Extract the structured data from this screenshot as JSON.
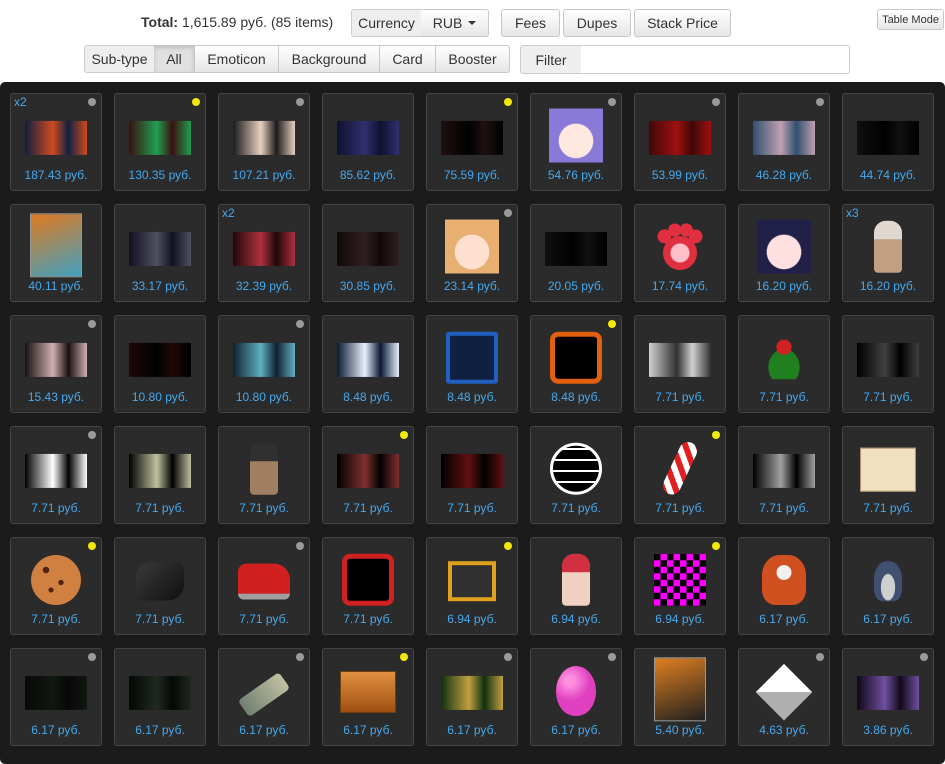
{
  "header": {
    "total_label": "Total:",
    "total_value": "1,615.89 руб. (85 items)",
    "currency_label": "Currency",
    "currency_value": "RUB",
    "fees": "Fees",
    "dupes": "Dupes",
    "stack_price": "Stack Price",
    "table_mode": "Table Mode"
  },
  "subtype": {
    "label": "Sub-type",
    "options": [
      "All",
      "Emoticon",
      "Background",
      "Card",
      "Booster"
    ],
    "selected": "All"
  },
  "filter": {
    "label": "Filter",
    "value": ""
  },
  "colors": {
    "price": "#45a8ef",
    "dot_gray": "#9a9a9a",
    "dot_yellow": "#f2e90c",
    "panel": "#1b1b1b"
  },
  "items": [
    {
      "price": "187.43 руб.",
      "qty": "x2",
      "dot": "gray",
      "kind": "bg",
      "colors": [
        "#102040",
        "#d04a20"
      ]
    },
    {
      "price": "130.35 руб.",
      "qty": "",
      "dot": "yellow",
      "kind": "bg",
      "colors": [
        "#3a1010",
        "#20a050"
      ]
    },
    {
      "price": "107.21 руб.",
      "qty": "",
      "dot": "gray",
      "kind": "bg",
      "colors": [
        "#1a1a1a",
        "#e8d0c0"
      ]
    },
    {
      "price": "85.62 руб.",
      "qty": "",
      "dot": "",
      "kind": "bg",
      "colors": [
        "#101030",
        "#303070"
      ]
    },
    {
      "price": "75.59 руб.",
      "qty": "",
      "dot": "yellow",
      "kind": "bg",
      "colors": [
        "#201010",
        "#000000"
      ]
    },
    {
      "price": "54.76 руб.",
      "qty": "",
      "dot": "gray",
      "kind": "emote",
      "colors": [
        "#8a7ad8",
        "#ffe8e0"
      ]
    },
    {
      "price": "53.99 руб.",
      "qty": "",
      "dot": "gray",
      "kind": "bg",
      "colors": [
        "#400808",
        "#a01010"
      ]
    },
    {
      "price": "46.28 руб.",
      "qty": "",
      "dot": "gray",
      "kind": "bg",
      "colors": [
        "#305070",
        "#c0a0b0"
      ]
    },
    {
      "price": "44.74 руб.",
      "qty": "",
      "dot": "",
      "kind": "bg",
      "colors": [
        "#101010",
        "#000000"
      ]
    },
    {
      "price": "40.11 руб.",
      "qty": "",
      "dot": "",
      "kind": "card",
      "colors": [
        "#e07a20",
        "#40a0c0"
      ]
    },
    {
      "price": "33.17 руб.",
      "qty": "",
      "dot": "",
      "kind": "bg",
      "colors": [
        "#101020",
        "#505060"
      ]
    },
    {
      "price": "32.39 руб.",
      "qty": "x2",
      "dot": "",
      "kind": "bg",
      "colors": [
        "#200808",
        "#b03040"
      ]
    },
    {
      "price": "30.85 руб.",
      "qty": "",
      "dot": "",
      "kind": "bg",
      "colors": [
        "#100808",
        "#302020"
      ]
    },
    {
      "price": "23.14 руб.",
      "qty": "",
      "dot": "gray",
      "kind": "emote",
      "colors": [
        "#e8b070",
        "#ffe0d0"
      ]
    },
    {
      "price": "20.05 руб.",
      "qty": "",
      "dot": "",
      "kind": "bg",
      "colors": [
        "#101010",
        "#000000"
      ]
    },
    {
      "price": "17.74 руб.",
      "qty": "",
      "dot": "",
      "kind": "paw",
      "colors": [
        "#e03040",
        "#ffc0c8"
      ]
    },
    {
      "price": "16.20 руб.",
      "qty": "",
      "dot": "",
      "kind": "emote",
      "colors": [
        "#202048",
        "#ffe0e0"
      ]
    },
    {
      "price": "16.20 руб.",
      "qty": "x3",
      "dot": "",
      "kind": "chibi",
      "colors": [
        "#e0d8d0",
        "#c0a080"
      ]
    },
    {
      "price": "15.43 руб.",
      "qty": "",
      "dot": "gray",
      "kind": "bg",
      "colors": [
        "#181010",
        "#d0b0b0"
      ]
    },
    {
      "price": "10.80 руб.",
      "qty": "",
      "dot": "",
      "kind": "bg",
      "colors": [
        "#200808",
        "#000000"
      ]
    },
    {
      "price": "10.80 руб.",
      "qty": "",
      "dot": "gray",
      "kind": "bg",
      "colors": [
        "#102030",
        "#60b0c0"
      ]
    },
    {
      "price": "8.48 руб.",
      "qty": "",
      "dot": "",
      "kind": "bg",
      "colors": [
        "#0a1830",
        "#e8f0ff"
      ]
    },
    {
      "price": "8.48 руб.",
      "qty": "",
      "dot": "",
      "kind": "frame",
      "colors": [
        "#2060c0",
        "#102040"
      ]
    },
    {
      "price": "8.48 руб.",
      "qty": "",
      "dot": "yellow",
      "kind": "face",
      "colors": [
        "#e06010",
        "#000000"
      ]
    },
    {
      "price": "7.71 руб.",
      "qty": "",
      "dot": "",
      "kind": "bg",
      "colors": [
        "#d0d0d0",
        "#303030"
      ]
    },
    {
      "price": "7.71 руб.",
      "qty": "",
      "dot": "",
      "kind": "mistletoe",
      "colors": [
        "#208020",
        "#d02020"
      ]
    },
    {
      "price": "7.71 руб.",
      "qty": "",
      "dot": "",
      "kind": "bg",
      "colors": [
        "#000000",
        "#404040"
      ]
    },
    {
      "price": "7.71 руб.",
      "qty": "",
      "dot": "gray",
      "kind": "bg",
      "colors": [
        "#000000",
        "#ffffff"
      ]
    },
    {
      "price": "7.71 руб.",
      "qty": "",
      "dot": "",
      "kind": "bg",
      "colors": [
        "#000000",
        "#c0c0a0"
      ]
    },
    {
      "price": "7.71 руб.",
      "qty": "",
      "dot": "",
      "kind": "chibi",
      "colors": [
        "#303030",
        "#a08060"
      ]
    },
    {
      "price": "7.71 руб.",
      "qty": "",
      "dot": "yellow",
      "kind": "bg",
      "colors": [
        "#000000",
        "#803030"
      ]
    },
    {
      "price": "7.71 руб.",
      "qty": "",
      "dot": "",
      "kind": "bg",
      "colors": [
        "#000000",
        "#601010"
      ]
    },
    {
      "price": "7.71 руб.",
      "qty": "",
      "dot": "",
      "kind": "globe",
      "colors": [
        "#ffffff",
        "#000000"
      ]
    },
    {
      "price": "7.71 руб.",
      "qty": "",
      "dot": "yellow",
      "kind": "cane",
      "colors": [
        "#e02020",
        "#ffffff"
      ]
    },
    {
      "price": "7.71 руб.",
      "qty": "",
      "dot": "",
      "kind": "bg",
      "colors": [
        "#000000",
        "#a0a0a0"
      ]
    },
    {
      "price": "7.71 руб.",
      "qty": "",
      "dot": "",
      "kind": "letter",
      "colors": [
        "#f0e0c0",
        "#c04040"
      ]
    },
    {
      "price": "7.71 руб.",
      "qty": "",
      "dot": "yellow",
      "kind": "cookie",
      "colors": [
        "#d08040",
        "#502010"
      ]
    },
    {
      "price": "7.71 руб.",
      "qty": "",
      "dot": "",
      "kind": "coal",
      "colors": [
        "#101010",
        "#3a3a3a"
      ]
    },
    {
      "price": "7.71 руб.",
      "qty": "",
      "dot": "gray",
      "kind": "car",
      "colors": [
        "#d02020",
        "#a0a0a0"
      ]
    },
    {
      "price": "7.71 руб.",
      "qty": "",
      "dot": "",
      "kind": "face",
      "colors": [
        "#d02020",
        "#000000"
      ]
    },
    {
      "price": "6.94 руб.",
      "qty": "",
      "dot": "yellow",
      "kind": "pixel",
      "colors": [
        "#e0a020",
        "#303030"
      ]
    },
    {
      "price": "6.94 руб.",
      "qty": "",
      "dot": "",
      "kind": "chibi",
      "colors": [
        "#d03040",
        "#f0d0c0"
      ]
    },
    {
      "price": "6.94 руб.",
      "qty": "",
      "dot": "yellow",
      "kind": "checker",
      "colors": [
        "#ff00ff",
        "#000000"
      ]
    },
    {
      "price": "6.17 руб.",
      "qty": "",
      "dot": "",
      "kind": "panda",
      "colors": [
        "#d05020",
        "#f0f0f0"
      ]
    },
    {
      "price": "6.17 руб.",
      "qty": "",
      "dot": "",
      "kind": "penguin",
      "colors": [
        "#405070",
        "#d0d0d0"
      ]
    },
    {
      "price": "6.17 руб.",
      "qty": "",
      "dot": "gray",
      "kind": "bg",
      "colors": [
        "#080808",
        "#101810"
      ]
    },
    {
      "price": "6.17 руб.",
      "qty": "",
      "dot": "",
      "kind": "bg",
      "colors": [
        "#050805",
        "#202820"
      ]
    },
    {
      "price": "6.17 руб.",
      "qty": "",
      "dot": "gray",
      "kind": "gun",
      "colors": [
        "#708070",
        "#c0c0a0"
      ]
    },
    {
      "price": "6.17 руб.",
      "qty": "",
      "dot": "yellow",
      "kind": "box",
      "colors": [
        "#e09040",
        "#a05010"
      ]
    },
    {
      "price": "6.17 руб.",
      "qty": "",
      "dot": "gray",
      "kind": "bg",
      "colors": [
        "#103010",
        "#c0a040"
      ]
    },
    {
      "price": "6.17 руб.",
      "qty": "",
      "dot": "gray",
      "kind": "balloon",
      "colors": [
        "#e040c0",
        "#ff90e0"
      ]
    },
    {
      "price": "5.40 руб.",
      "qty": "",
      "dot": "",
      "kind": "card",
      "colors": [
        "#e08020",
        "#202020"
      ]
    },
    {
      "price": "4.63 руб.",
      "qty": "",
      "dot": "gray",
      "kind": "cube",
      "colors": [
        "#ffffff",
        "#b0b0b0"
      ]
    },
    {
      "price": "3.86 руб.",
      "qty": "",
      "dot": "gray",
      "kind": "bg",
      "colors": [
        "#100818",
        "#7050a0"
      ]
    }
  ]
}
